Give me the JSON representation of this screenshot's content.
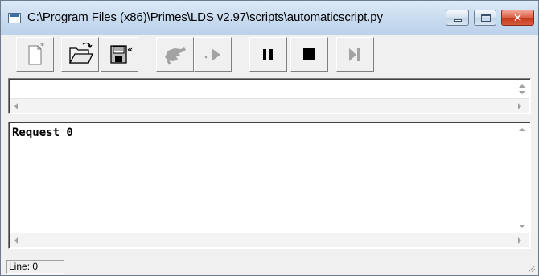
{
  "window": {
    "title": "C:\\Program Files (x86)\\Primes\\LDS v2.97\\scripts\\automaticscript.py",
    "icon": "script-window-icon",
    "controls": {
      "minimize": "minimize-icon",
      "maximize": "maximize-icon",
      "close": "✕"
    }
  },
  "toolbar": {
    "buttons": [
      {
        "name": "new-file",
        "icon": "new-document-icon",
        "enabled": true
      },
      {
        "name": "open-file",
        "icon": "open-folder-icon",
        "enabled": true
      },
      {
        "name": "save-file",
        "icon": "floppy-disk-icon",
        "enabled": true
      },
      {
        "name": "step",
        "icon": "step-hand-icon",
        "enabled": false
      },
      {
        "name": "run",
        "icon": "play-icon",
        "enabled": false
      },
      {
        "name": "pause",
        "icon": "pause-icon",
        "enabled": true
      },
      {
        "name": "stop",
        "icon": "stop-icon",
        "enabled": true
      },
      {
        "name": "skip",
        "icon": "skip-forward-icon",
        "enabled": false
      }
    ]
  },
  "input_pane": {
    "value": ""
  },
  "output_pane": {
    "text": "Request 0"
  },
  "status": {
    "line_label": "Line: 0"
  },
  "colors": {
    "title_bar": "#c8dbef",
    "close_button": "#c43a1e",
    "disabled_icon": "#a0a0a0"
  }
}
